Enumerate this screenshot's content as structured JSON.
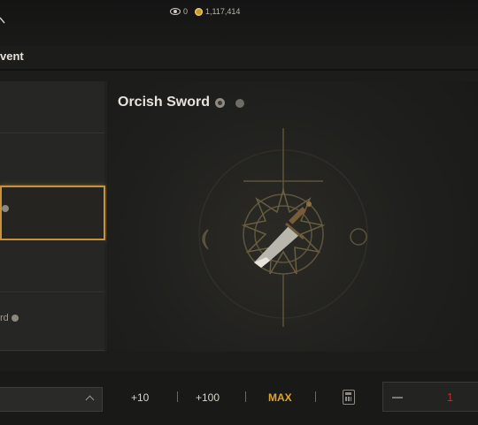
{
  "currency": {
    "eye_count": "0",
    "gold": "1,117,414"
  },
  "tab": {
    "label": "vent"
  },
  "list": {
    "rows": [
      {
        "text": ""
      },
      {
        "text": ""
      },
      {
        "text": ""
      },
      {
        "text": ""
      },
      {
        "text": "rd"
      }
    ],
    "selected_index": 2
  },
  "item": {
    "name": "Orcish Sword"
  },
  "quantity_controls": {
    "plus10": "+10",
    "plus100": "+100",
    "max": "MAX",
    "value": "1"
  },
  "colors": {
    "accent_gold": "#d9a431",
    "selection_border": "#c8923b",
    "quantity_red": "#b0332a"
  }
}
